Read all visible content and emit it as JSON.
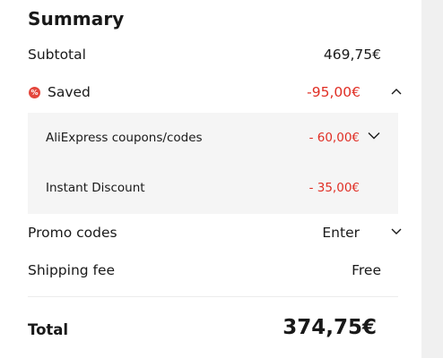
{
  "summary": {
    "title": "Summary",
    "subtotal": {
      "label": "Subtotal",
      "value": "469,75€"
    },
    "saved": {
      "icon_glyph": "%",
      "label": "Saved",
      "value": "-95,00€",
      "expanded": true,
      "items": [
        {
          "label": "AliExpress coupons/codes",
          "value": "- 60,00€"
        },
        {
          "label": "Instant Discount",
          "value": "- 35,00€"
        }
      ]
    },
    "promo": {
      "label": "Promo codes",
      "action": "Enter"
    },
    "shipping": {
      "label": "Shipping fee",
      "value": "Free"
    },
    "total": {
      "label": "Total",
      "value": "374,75€"
    }
  },
  "colors": {
    "discount_red": "#e02e24",
    "saved_icon_bg": "#e4473d",
    "subpanel_bg": "#f5f5f5",
    "page_bg": "#f0f0f0"
  }
}
